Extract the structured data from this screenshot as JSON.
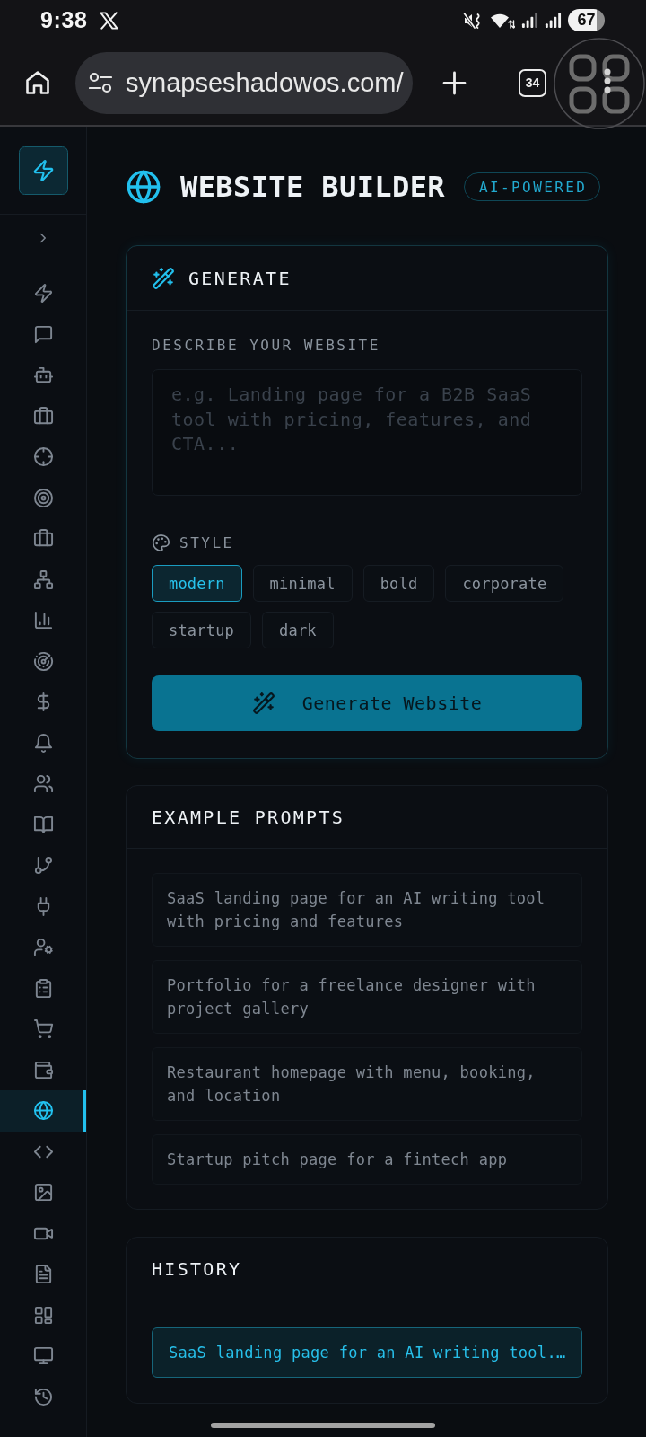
{
  "status_bar": {
    "time": "9:38",
    "battery": "67"
  },
  "browser": {
    "url": "synapseshadowos.com/",
    "tab_count": "34"
  },
  "sidebar": {
    "items": [
      {
        "selected": false
      },
      {
        "selected": false
      },
      {
        "selected": false
      },
      {
        "selected": false
      },
      {
        "selected": false
      },
      {
        "selected": false
      },
      {
        "selected": false
      },
      {
        "selected": false
      },
      {
        "selected": false
      },
      {
        "selected": false
      },
      {
        "selected": false
      },
      {
        "selected": false
      },
      {
        "selected": false
      },
      {
        "selected": false
      },
      {
        "selected": false
      },
      {
        "selected": false
      },
      {
        "selected": false
      },
      {
        "selected": false
      },
      {
        "selected": false
      },
      {
        "selected": false
      },
      {
        "selected": true
      },
      {
        "selected": false
      },
      {
        "selected": false
      },
      {
        "selected": false
      },
      {
        "selected": false
      },
      {
        "selected": false
      },
      {
        "selected": false
      },
      {
        "selected": false
      }
    ]
  },
  "header": {
    "title": "WEBSITE BUILDER",
    "badge": "AI-POWERED"
  },
  "generate": {
    "title": "GENERATE",
    "prompt": {
      "label": "DESCRIBE YOUR WEBSITE",
      "placeholder": "e.g. Landing page for a B2B SaaS tool with pricing, features, and CTA..."
    },
    "style": {
      "label": "STYLE",
      "options": [
        {
          "label": "modern",
          "selected": true
        },
        {
          "label": "minimal",
          "selected": false
        },
        {
          "label": "bold",
          "selected": false
        },
        {
          "label": "corporate",
          "selected": false
        },
        {
          "label": "startup",
          "selected": false
        },
        {
          "label": "dark",
          "selected": false
        }
      ]
    },
    "button": "Generate Website"
  },
  "examples": {
    "title": "EXAMPLE PROMPTS",
    "items": [
      "SaaS landing page for an AI writing tool with pricing and features",
      "Portfolio for a freelance designer with project gallery",
      "Restaurant homepage with menu, booking, and location",
      "Startup pitch page for a fintech app"
    ]
  },
  "history": {
    "title": "HISTORY",
    "items": [
      {
        "text": "SaaS landing page for an AI writing tool.…",
        "selected": true
      }
    ]
  }
}
